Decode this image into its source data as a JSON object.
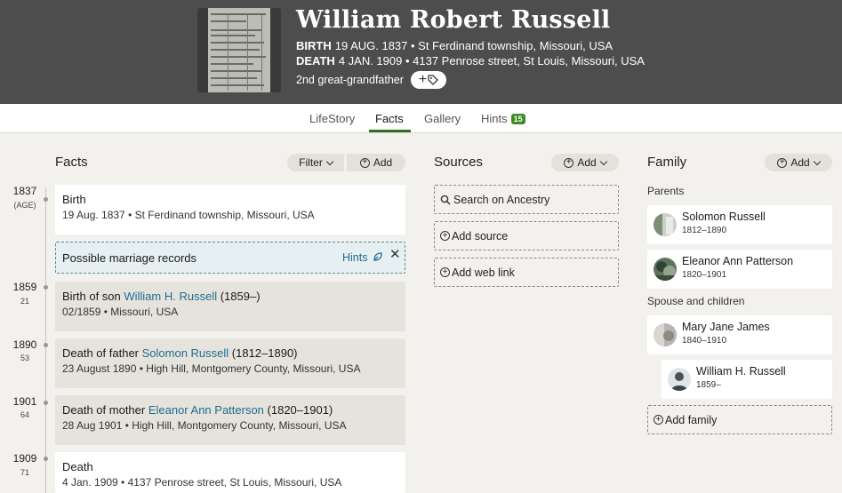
{
  "header": {
    "name": "William Robert Russell",
    "birth_label": "BIRTH",
    "birth_value": "19 AUG. 1837 • St Ferdinand township, Missouri, USA",
    "death_label": "DEATH",
    "death_value": "4 JAN. 1909 • 4137 Penrose street, St Louis, Missouri, USA",
    "relationship": "2nd great-grandfather"
  },
  "tabs": {
    "lifestory": "LifeStory",
    "facts": "Facts",
    "gallery": "Gallery",
    "hints": "Hints",
    "hints_count": "15"
  },
  "facts_section": {
    "title": "Facts",
    "filter_label": "Filter",
    "add_label": "Add"
  },
  "timeline": [
    {
      "year": "1837",
      "age": "(AGE)"
    },
    {
      "year": "1859",
      "age": "21"
    },
    {
      "year": "1890",
      "age": "53"
    },
    {
      "year": "1901",
      "age": "64"
    },
    {
      "year": "1909",
      "age": "71"
    }
  ],
  "facts": {
    "birth": {
      "title": "Birth",
      "detail": "19 Aug. 1837 • St Ferdinand township, Missouri, USA"
    },
    "hint": {
      "text": "Possible marriage records",
      "link": "Hints"
    },
    "son": {
      "prefix": "Birth of son ",
      "person": "William H. Russell",
      "suffix": " (1859–)",
      "detail": "02/1859 • Missouri, USA"
    },
    "father": {
      "prefix": "Death of father ",
      "person": "Solomon Russell",
      "suffix": " (1812–1890)",
      "detail": "23 August 1890 • High Hill, Montgomery County, Missouri, USA"
    },
    "mother": {
      "prefix": "Death of mother ",
      "person": "Eleanor Ann Patterson",
      "suffix": " (1820–1901)",
      "detail": "28 Aug 1901 • High Hill, Montgomery County, Missouri, USA"
    },
    "death": {
      "title": "Death",
      "detail": "4 Jan. 1909 • 4137 Penrose street, St Louis, Missouri, USA"
    }
  },
  "sources": {
    "title": "Sources",
    "add_label": "Add",
    "search": "Search on Ancestry",
    "add_source": "Add source",
    "add_web_link": "Add web link"
  },
  "family": {
    "title": "Family",
    "add_label": "Add",
    "parents_label": "Parents",
    "spouse_label": "Spouse and children",
    "add_family": "Add family",
    "people": {
      "solomon": {
        "name": "Solomon Russell",
        "dates": "1812–1890"
      },
      "eleanor": {
        "name": "Eleanor Ann Patterson",
        "dates": "1820–1901"
      },
      "mary": {
        "name": "Mary Jane James",
        "dates": "1840–1910"
      },
      "william": {
        "name": "William H. Russell",
        "dates": "1859–"
      }
    }
  },
  "colors": {
    "header_bg": "#4d4d4d",
    "accent_green": "#2f6e1f",
    "link_blue": "#1f6c8f",
    "page_bg": "#f3f1ed"
  }
}
